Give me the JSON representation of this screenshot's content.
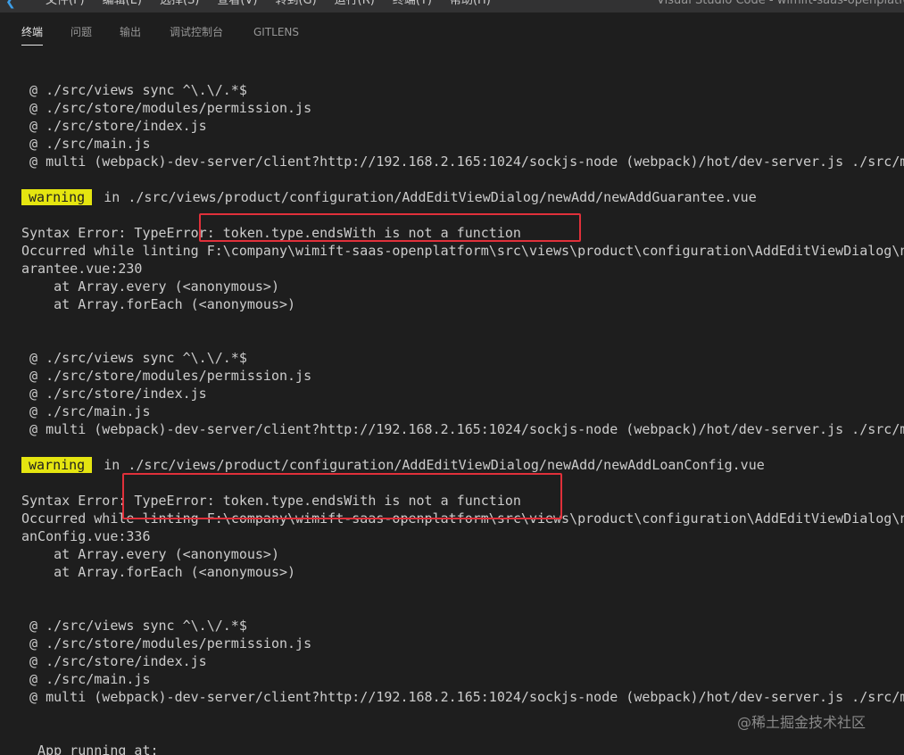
{
  "window": {
    "title": "Visual Studio Code - wimift-saas-openplatfo",
    "menus": [
      "文件(F)",
      "编辑(E)",
      "选择(S)",
      "查看(V)",
      "转到(G)",
      "运行(R)",
      "终端(T)",
      "帮助(H)"
    ]
  },
  "panel": {
    "tabs": [
      {
        "label": "终端",
        "active": true
      },
      {
        "label": "问题",
        "active": false
      },
      {
        "label": "输出",
        "active": false
      },
      {
        "label": "调试控制台",
        "active": false
      },
      {
        "label": "GITLENS",
        "active": false
      }
    ]
  },
  "terminal": {
    "lines": [
      " @ ./src/views sync ^\\.\\/.*$",
      " @ ./src/store/modules/permission.js",
      " @ ./src/store/index.js",
      " @ ./src/main.js",
      " @ multi (webpack)-dev-server/client?http://192.168.2.165:1024/sockjs-node (webpack)/hot/dev-server.js ./src/main.js",
      "",
      " in ./src/views/product/configuration/AddEditViewDialog/newAdd/newAddGuarantee.vue",
      "",
      "Syntax Error: TypeError: token.type.endsWith is not a function",
      "Occurred while linting F:\\company\\wimift-saas-openplatform\\src\\views\\product\\configuration\\AddEditViewDialog\\newAdd\\newAddGu",
      "arantee.vue:230",
      "    at Array.every (<anonymous>)",
      "    at Array.forEach (<anonymous>)",
      "",
      "",
      " @ ./src/views sync ^\\.\\/.*$",
      " @ ./src/store/modules/permission.js",
      " @ ./src/store/index.js",
      " @ ./src/main.js",
      " @ multi (webpack)-dev-server/client?http://192.168.2.165:1024/sockjs-node (webpack)/hot/dev-server.js ./src/main.js",
      "",
      " in ./src/views/product/configuration/AddEditViewDialog/newAdd/newAddLoanConfig.vue",
      "",
      "Syntax Error: TypeError: token.type.endsWith is not a function",
      "Occurred while linting F:\\company\\wimift-saas-openplatform\\src\\views\\product\\configuration\\AddEditViewDialog\\newAdd\\newAddLo",
      "anConfig.vue:336",
      "    at Array.every (<anonymous>)",
      "    at Array.forEach (<anonymous>)",
      "",
      "",
      " @ ./src/views sync ^\\.\\/.*$",
      " @ ./src/store/modules/permission.js",
      " @ ./src/store/index.js",
      " @ ./src/main.js",
      " @ multi (webpack)-dev-server/client?http://192.168.2.165:1024/sockjs-node (webpack)/hot/dev-server.js ./src/main.js",
      "",
      "",
      "  App running at:"
    ],
    "warning_label": "warning",
    "warning_line_indices": [
      6,
      21
    ]
  },
  "colors": {
    "background": "#1e1e1e",
    "foreground": "#cccccc",
    "warning_badge": "#e5e510",
    "annotation_box": "#e0303a"
  },
  "watermark": "@稀土掘金技术社区"
}
